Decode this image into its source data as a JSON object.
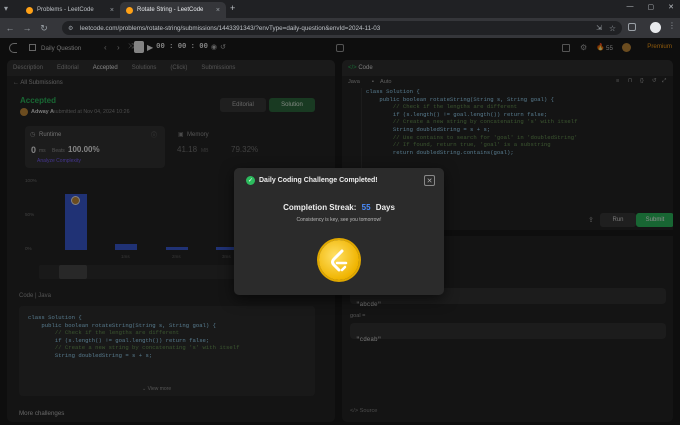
{
  "browser": {
    "tabs": [
      {
        "title": "Problems - LeetCode"
      },
      {
        "title": "Rotate String - LeetCode"
      }
    ],
    "url": "leetcode.com/problems/rotate-string/submissions/1443391343/?envType=daily-question&envId=2024-11-03"
  },
  "nav": {
    "daily_question": "Daily Question",
    "timer": "00 : 00 : 00",
    "streak_count": "55",
    "premium": "Premium"
  },
  "left": {
    "tabs": [
      "Description",
      "Editorial",
      "Accepted",
      "Solutions",
      "(Click)",
      "Submissions"
    ],
    "back_link": "All Submissions",
    "status": "Accepted",
    "user": "Adway A",
    "submitted": "submitted at Nov 04, 2024 10:26",
    "editorial_btn": "Editorial",
    "solution_btn": "Solution",
    "runtime_label": "Runtime",
    "runtime_value": "0",
    "runtime_unit": "ms",
    "beats_label": "Beats",
    "runtime_beats": "100.00%",
    "analyze": "Analyze Complexity",
    "memory_label": "Memory",
    "memory_value": "41.18",
    "memory_unit": "MB",
    "memory_beats": "79.32%",
    "chart_y": [
      "100%",
      "50%",
      "0%"
    ],
    "chart_x": [
      "1ms",
      "2ms",
      "3ms"
    ],
    "code_header": "Code",
    "code_lang": "Java",
    "code_lines": [
      "class Solution {",
      "",
      "    public boolean rotateString(String s, String goal) {",
      "        // Check if the lengths are different",
      "        if (s.length() != goal.length()) return false;",
      "",
      "        // Create a new string by concatenating 's' with itself",
      "        String doubledString = s + s;"
    ],
    "view_more": "View more",
    "more_challenges": "More challenges"
  },
  "right": {
    "header": "Code",
    "lang": "Java",
    "auto": "Auto",
    "code_lines": [
      "class Solution {",
      "",
      "    public boolean rotateString(String s, String goal) {",
      "        // Check if the lengths are different",
      "        if (s.length() != goal.length()) return false;",
      "",
      "        // Create a new string by concatenating 's' with itself",
      "        String doubledString = s + s;",
      "",
      "        // Use contains to search for 'goal' in 'doubledString'",
      "        // If found, return true, 'goal' is a substring",
      "        return doubledString.contains(goal);"
    ],
    "run": "Run",
    "submit": "Submit",
    "input_s": "\"abcde\"",
    "goal_label": "goal =",
    "input_goal": "\"cdeab\"",
    "source": "Source"
  },
  "modal": {
    "title": "Daily Coding Challenge Completed!",
    "streak_label": "Completion Streak:",
    "streak_value": "55",
    "streak_unit": "Days",
    "message": "Consistency is key, see you tomorrow!"
  },
  "colors": {
    "accent": "#ffa116",
    "success": "#2cbb5d",
    "blue": "#4a8dff",
    "bar": "#3b5bd6"
  }
}
